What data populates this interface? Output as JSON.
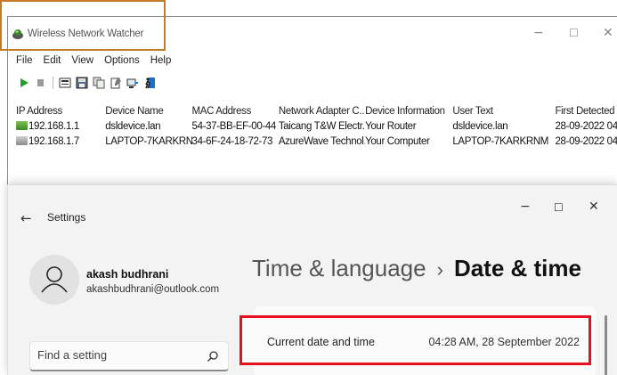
{
  "network_watcher": {
    "title": "Wireless Network Watcher",
    "controls": {
      "minimize": "−",
      "maximize": "☐",
      "close": "✕"
    },
    "menu": [
      "File",
      "Edit",
      "View",
      "Options",
      "Help"
    ],
    "toolbar_icons": [
      "play-icon",
      "stop-icon",
      "html-report-icon",
      "save-icon",
      "copy-icon",
      "properties-icon",
      "network-adapter-icon",
      "exit-icon"
    ],
    "columns": [
      "IP Address",
      "Device Name",
      "MAC Address",
      "Network Adapter C...",
      "Device Information",
      "User Text",
      "First Detected"
    ],
    "rows": [
      {
        "icon": "router-icon",
        "ip": "192.168.1.1",
        "device": "dsldevice.lan",
        "mac": "54-37-BB-EF-00-44",
        "adapter": "Taicang T&W Electr...",
        "info": "Your Router",
        "user_text": "dsldevice.lan",
        "first": "28-09-2022 04"
      },
      {
        "icon": "computer-icon",
        "ip": "192.168.1.7",
        "device": "LAPTOP-7KARKRNM",
        "mac": "34-6F-24-18-72-73",
        "adapter": "AzureWave Technol...",
        "info": "Your Computer",
        "user_text": "LAPTOP-7KARKRNM",
        "first": "28-09-2022 04"
      }
    ],
    "highlight_color": "#c77a26"
  },
  "settings": {
    "title": "Settings",
    "back_glyph": "←",
    "controls": {
      "minimize": "−",
      "maximize": "☐",
      "close": "✕"
    },
    "user": {
      "name": "akash budhrani",
      "email": "akashbudhrani@outlook.com"
    },
    "breadcrumb": {
      "parent": "Time & language",
      "separator": "›",
      "current": "Date & time"
    },
    "search": {
      "placeholder": "Find a setting"
    },
    "date_time_row": {
      "label": "Current date and time",
      "value": "04:28 AM, 28 September 2022"
    },
    "highlight_color": "#e8101a"
  }
}
